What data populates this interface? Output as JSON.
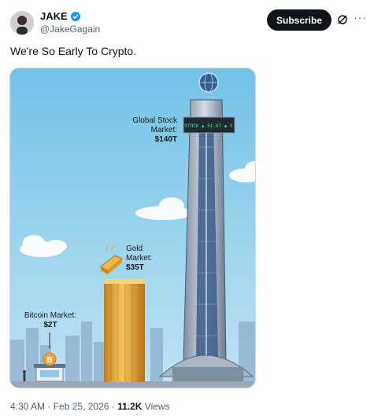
{
  "author": {
    "display_name": "JAKE",
    "handle": "@JakeGagain",
    "verified_icon": "verified-badge-icon"
  },
  "actions": {
    "subscribe_label": "Subscribe",
    "grok_icon": "grok-icon",
    "more_icon": "more-icon"
  },
  "tweet": {
    "text": "We're So Early To Crypto."
  },
  "image": {
    "stock_label_line1": "Global Stock",
    "stock_label_line2": "Market:",
    "stock_value": "$140T",
    "gold_label_line1": "Gold",
    "gold_label_line2": "Market:",
    "gold_value": "$35T",
    "bitcoin_label": "Bitcoin Market:",
    "bitcoin_value": "$2T",
    "bitcoin_symbol": "B",
    "ticker_text": "STOCK ▲ 51.67 ▲ 5"
  },
  "meta": {
    "time": "4:30 AM",
    "sep1": " · ",
    "date": "Feb 25, 2026",
    "sep2": " · ",
    "views_count": "11.2K",
    "views_label": " Views"
  },
  "colors": {
    "sky": "#76c4e6",
    "subscribe_bg": "#0f1419",
    "verified": "#1d9bf0",
    "gold": "#e2a43a",
    "bitcoin": "#f2a33a"
  }
}
